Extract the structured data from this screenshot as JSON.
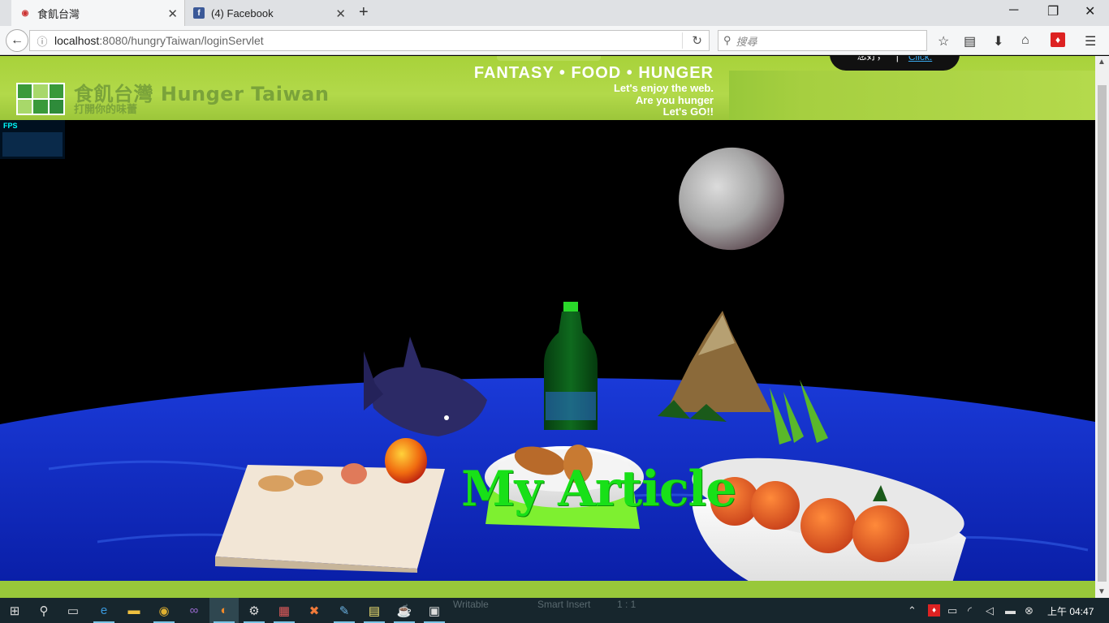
{
  "browser": {
    "tabs": [
      {
        "title": "食飢台灣",
        "favicon": "hunger-taiwan-favicon",
        "active": true
      },
      {
        "title": "(4) Facebook",
        "favicon": "facebook-favicon",
        "active": false
      }
    ],
    "url_host": "localhost",
    "url_path": ":8080/hungryTaiwan/loginServlet",
    "search_placeholder": "搜尋",
    "toolbar_icons": [
      "bookmark-star-icon",
      "reading-list-icon",
      "download-icon",
      "home-icon",
      "app-icon",
      "menu-icon"
    ]
  },
  "header": {
    "site_title": "食飢台灣 Hunger Taiwan",
    "site_subtitle": "打開你的味蕾",
    "slogan": "FANTASY • FOOD • HUNGER",
    "tagline_1": "Let's enjoy the web.",
    "tagline_2": "Are you hunger",
    "tagline_3": "Let's GO!!",
    "user_greeting": "您好，",
    "user_link": "Click.",
    "colors": {
      "bar": "#a8d23a",
      "logo_dark": "#2e8b3a",
      "logo_light": "#a8d86a"
    }
  },
  "fps": {
    "label": "FPS"
  },
  "scene": {
    "label": "My Article",
    "label_color": "#18e018",
    "objects": [
      "moon",
      "bottle",
      "shark",
      "mountain",
      "fruit-bowl",
      "bread-plate",
      "cutting-board",
      "apple",
      "sea"
    ]
  },
  "taskbar": {
    "ghost_writable": "Writable",
    "ghost_insert": "Smart Insert",
    "ghost_pos": "1 : 1",
    "clock": "上午 04:47",
    "apps": [
      "start-icon",
      "search-icon",
      "task-view-icon",
      "edge-icon",
      "file-explorer-icon",
      "chrome-icon",
      "visual-studio-icon",
      "firefox-icon",
      "settings-icon",
      "app-icon",
      "xampp-icon",
      "paint-icon",
      "notepad-icon",
      "java-icon",
      "terminal-icon"
    ]
  }
}
